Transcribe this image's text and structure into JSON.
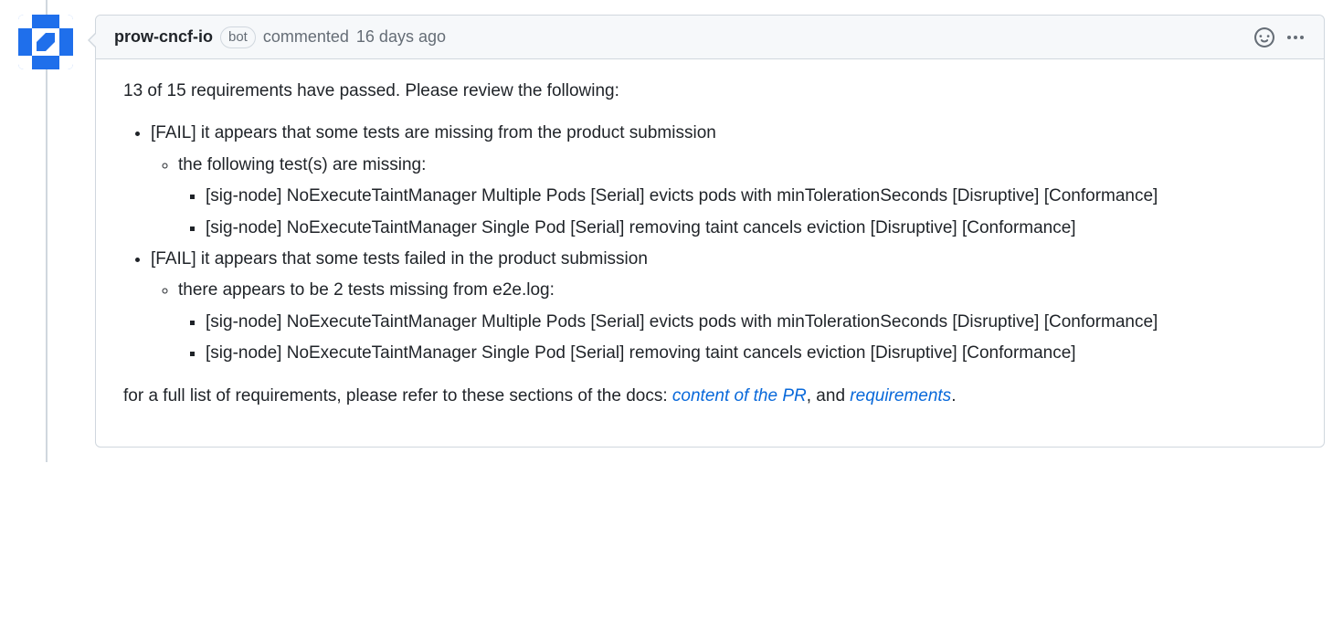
{
  "comment": {
    "author": "prow-cncf-io",
    "bot_label": "bot",
    "action_text": "commented",
    "timestamp": "16 days ago",
    "body": {
      "intro": "13 of 15 requirements have passed. Please review the following:",
      "failures": [
        {
          "title": "[FAIL] it appears that some tests are missing from the product submission",
          "subtitle": "the following test(s) are missing:",
          "items": [
            "[sig-node] NoExecuteTaintManager Multiple Pods [Serial] evicts pods with minTolerationSeconds [Disruptive] [Conformance]",
            "[sig-node] NoExecuteTaintManager Single Pod [Serial] removing taint cancels eviction [Disruptive] [Conformance]"
          ]
        },
        {
          "title": "[FAIL] it appears that some tests failed in the product submission",
          "subtitle": "there appears to be 2 tests missing from e2e.log:",
          "items": [
            "[sig-node] NoExecuteTaintManager Multiple Pods [Serial] evicts pods with minTolerationSeconds [Disruptive] [Conformance]",
            "[sig-node] NoExecuteTaintManager Single Pod [Serial] removing taint cancels eviction [Disruptive] [Conformance]"
          ]
        }
      ],
      "footer_prefix": "for a full list of requirements, please refer to these sections of the docs: ",
      "footer_link1": "content of the PR",
      "footer_mid": ", and ",
      "footer_link2": "requirements",
      "footer_suffix": "."
    }
  }
}
